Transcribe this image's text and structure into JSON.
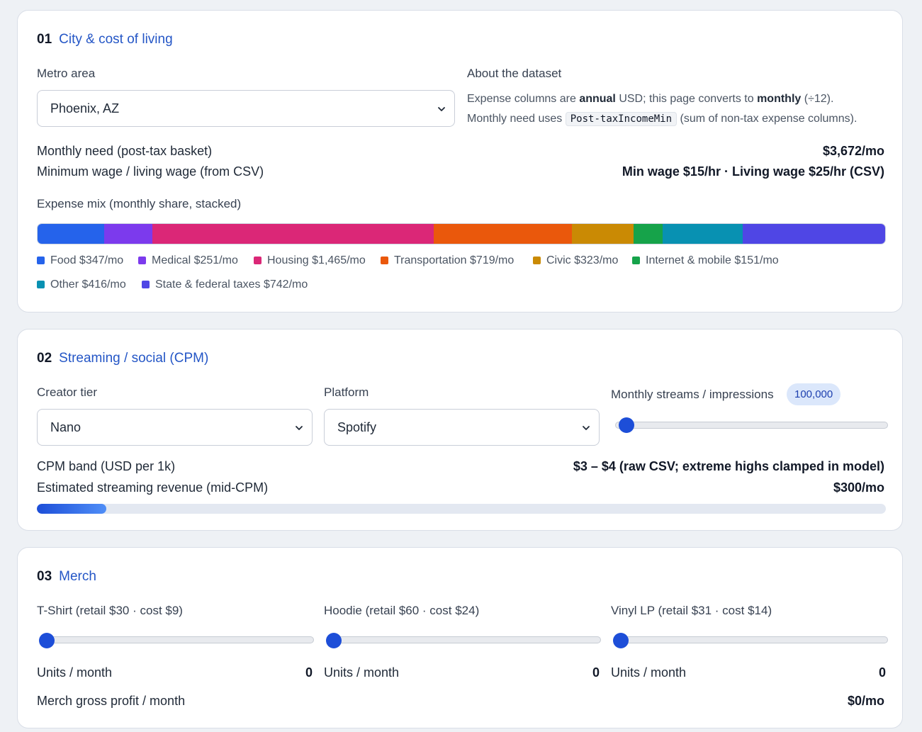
{
  "city": {
    "num": "01",
    "title": "City & cost of living",
    "metro_label": "Metro area",
    "metro_value": "Phoenix, AZ",
    "about_label": "About the dataset",
    "about_p1_a": "Expense columns are ",
    "about_p1_b": "annual",
    "about_p1_c": " USD; this page converts to ",
    "about_p1_d": "monthly",
    "about_p1_e": " (÷12).",
    "about_p2_a": "Monthly need uses ",
    "about_p2_code": "Post-taxIncomeMin",
    "about_p2_b": " (sum of non-tax expense columns).",
    "need_label": "Monthly need (post-tax basket)",
    "need_value": "$3,672/mo",
    "wage_label": "Minimum wage / living wage (from CSV)",
    "wage_value": "Min wage $15/hr · Living wage $25/hr (CSV)",
    "mix_label": "Expense mix (monthly share, stacked)"
  },
  "chart_data": {
    "type": "bar",
    "stacked": true,
    "unit": "$/mo",
    "categories": [
      "Food",
      "Medical",
      "Housing",
      "Transportation",
      "Civic",
      "Internet & mobile",
      "Other",
      "State & federal taxes"
    ],
    "values": [
      347,
      251,
      1465,
      719,
      323,
      151,
      416,
      742
    ],
    "labels": [
      "Food $347/mo",
      "Medical $251/mo",
      "Housing $1,465/mo",
      "Transportation $719/mo",
      "Civic $323/mo",
      "Internet & mobile $151/mo",
      "Other $416/mo",
      "State & federal taxes $742/mo"
    ],
    "colors": [
      "#2563eb",
      "#7c3aed",
      "#db2777",
      "#ea580c",
      "#ca8a04",
      "#16a34a",
      "#0891b2",
      "#4f46e5"
    ],
    "legend": "bottom"
  },
  "streaming": {
    "num": "02",
    "title": "Streaming / social (CPM)",
    "tier_label": "Creator tier",
    "tier_value": "Nano",
    "platform_label": "Platform",
    "platform_value": "Spotify",
    "streams_label": "Monthly streams / impressions",
    "streams_value": "100,000",
    "streams_slider_fraction": 0.005,
    "cpm_label": "CPM band (USD per 1k)",
    "cpm_value": "$3 – $4 (raw CSV; extreme highs clamped in model)",
    "rev_label": "Estimated streaming revenue (mid-CPM)",
    "rev_value": "$300/mo",
    "rev_fraction": 0.082
  },
  "merch": {
    "num": "03",
    "title": "Merch",
    "items": [
      {
        "label": "T-Shirt (retail $30 · cost $9)",
        "units_label": "Units / month",
        "units": "0"
      },
      {
        "label": "Hoodie (retail $60 · cost $24)",
        "units_label": "Units / month",
        "units": "0"
      },
      {
        "label": "Vinyl LP (retail $31 · cost $14)",
        "units_label": "Units / month",
        "units": "0"
      }
    ],
    "profit_label": "Merch gross profit / month",
    "profit_value": "$0/mo"
  },
  "colors": {
    "accent": "#2456c6",
    "slider": "#1d4ed8"
  },
  "icons": {
    "select": "chevron-down-icon"
  }
}
